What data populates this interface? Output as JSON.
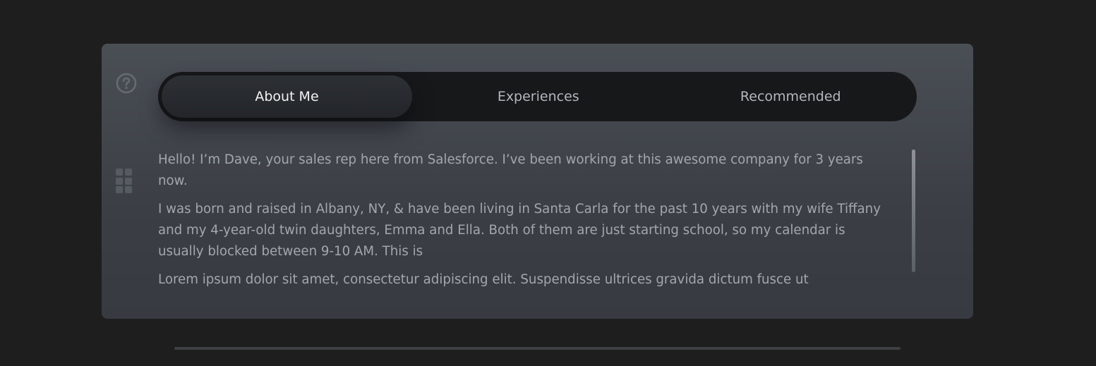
{
  "tabs": [
    {
      "label": "About Me",
      "active": true
    },
    {
      "label": "Experiences",
      "active": false
    },
    {
      "label": "Recommended",
      "active": false
    }
  ],
  "content": {
    "paragraphs": [
      "Hello! I’m Dave, your sales rep here from Salesforce. I’ve been working at this awesome company for 3 years now.",
      "I was born and raised in Albany, NY, & have been living in Santa Carla for the past 10 years with my wife Tiffany and my 4-year-old twin daughters, Emma and Ella. Both of them are just starting school, so my calendar is usually blocked between 9-10 AM. This is",
      "Lorem ipsum dolor sit amet, consectetur adipiscing elit. Suspendisse ultrices gravida dictum fusce ut"
    ]
  },
  "icons": {
    "help": "question-circle-icon",
    "drag": "grip-icon"
  },
  "colors": {
    "background": "#1e1e1e",
    "card": "#44484f",
    "tab_bar": "#171819",
    "active_tab": "#282b30",
    "text": "#a3a7ad"
  }
}
